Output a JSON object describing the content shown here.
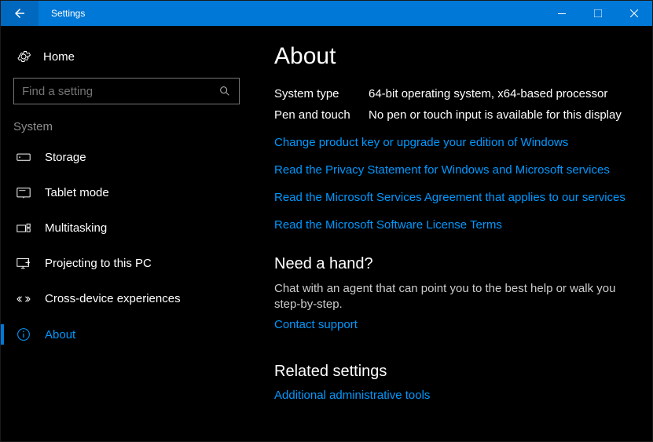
{
  "window": {
    "title": "Settings"
  },
  "sidebar": {
    "home_label": "Home",
    "search_placeholder": "Find a setting",
    "section_label": "System",
    "items": [
      {
        "label": "Storage"
      },
      {
        "label": "Tablet mode"
      },
      {
        "label": "Multitasking"
      },
      {
        "label": "Projecting to this PC"
      },
      {
        "label": "Cross-device experiences"
      },
      {
        "label": "About"
      }
    ]
  },
  "content": {
    "page_title": "About",
    "info": [
      {
        "key": "System type",
        "val": "64-bit operating system, x64-based processor"
      },
      {
        "key": "Pen and touch",
        "val": "No pen or touch input is available for this display"
      }
    ],
    "links": [
      "Change product key or upgrade your edition of Windows",
      "Read the Privacy Statement for Windows and Microsoft services",
      "Read the Microsoft Services Agreement that applies to our services",
      "Read the Microsoft Software License Terms"
    ],
    "help_heading": "Need a hand?",
    "help_body": "Chat with an agent that can point you to the best help or walk you step-by-step.",
    "help_link": "Contact support",
    "related_heading": "Related settings",
    "related_link": "Additional administrative tools"
  }
}
